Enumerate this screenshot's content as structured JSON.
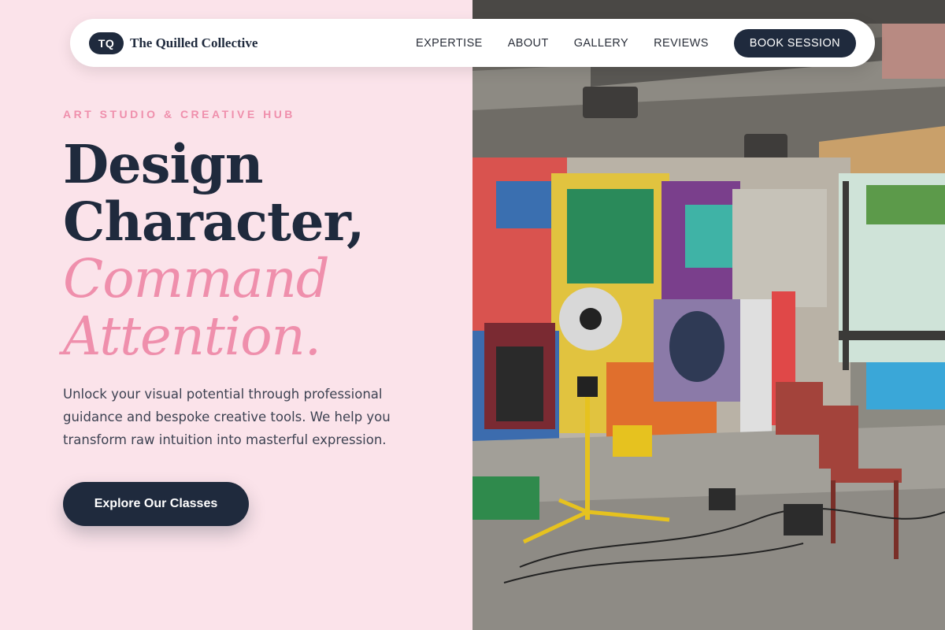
{
  "brand": {
    "badge": "TQ",
    "name": "The Quilled Collective"
  },
  "nav": {
    "links": [
      "EXPERTISE",
      "ABOUT",
      "GALLERY",
      "REVIEWS"
    ],
    "cta": "BOOK SESSION"
  },
  "hero": {
    "eyebrow": "ART STUDIO & CREATIVE HUB",
    "headline_line1": "Design",
    "headline_line2": "Character,",
    "headline_accent_line1": "Command",
    "headline_accent_line2": "Attention.",
    "body": "Unlock your visual potential through professional guidance and bespoke creative tools. We help you transform raw intuition into masterful expression.",
    "cta": "Explore Our Classes"
  },
  "colors": {
    "background_pink": "#fbe3ea",
    "accent_pink": "#ef8fac",
    "navy": "#1f2a3d"
  }
}
